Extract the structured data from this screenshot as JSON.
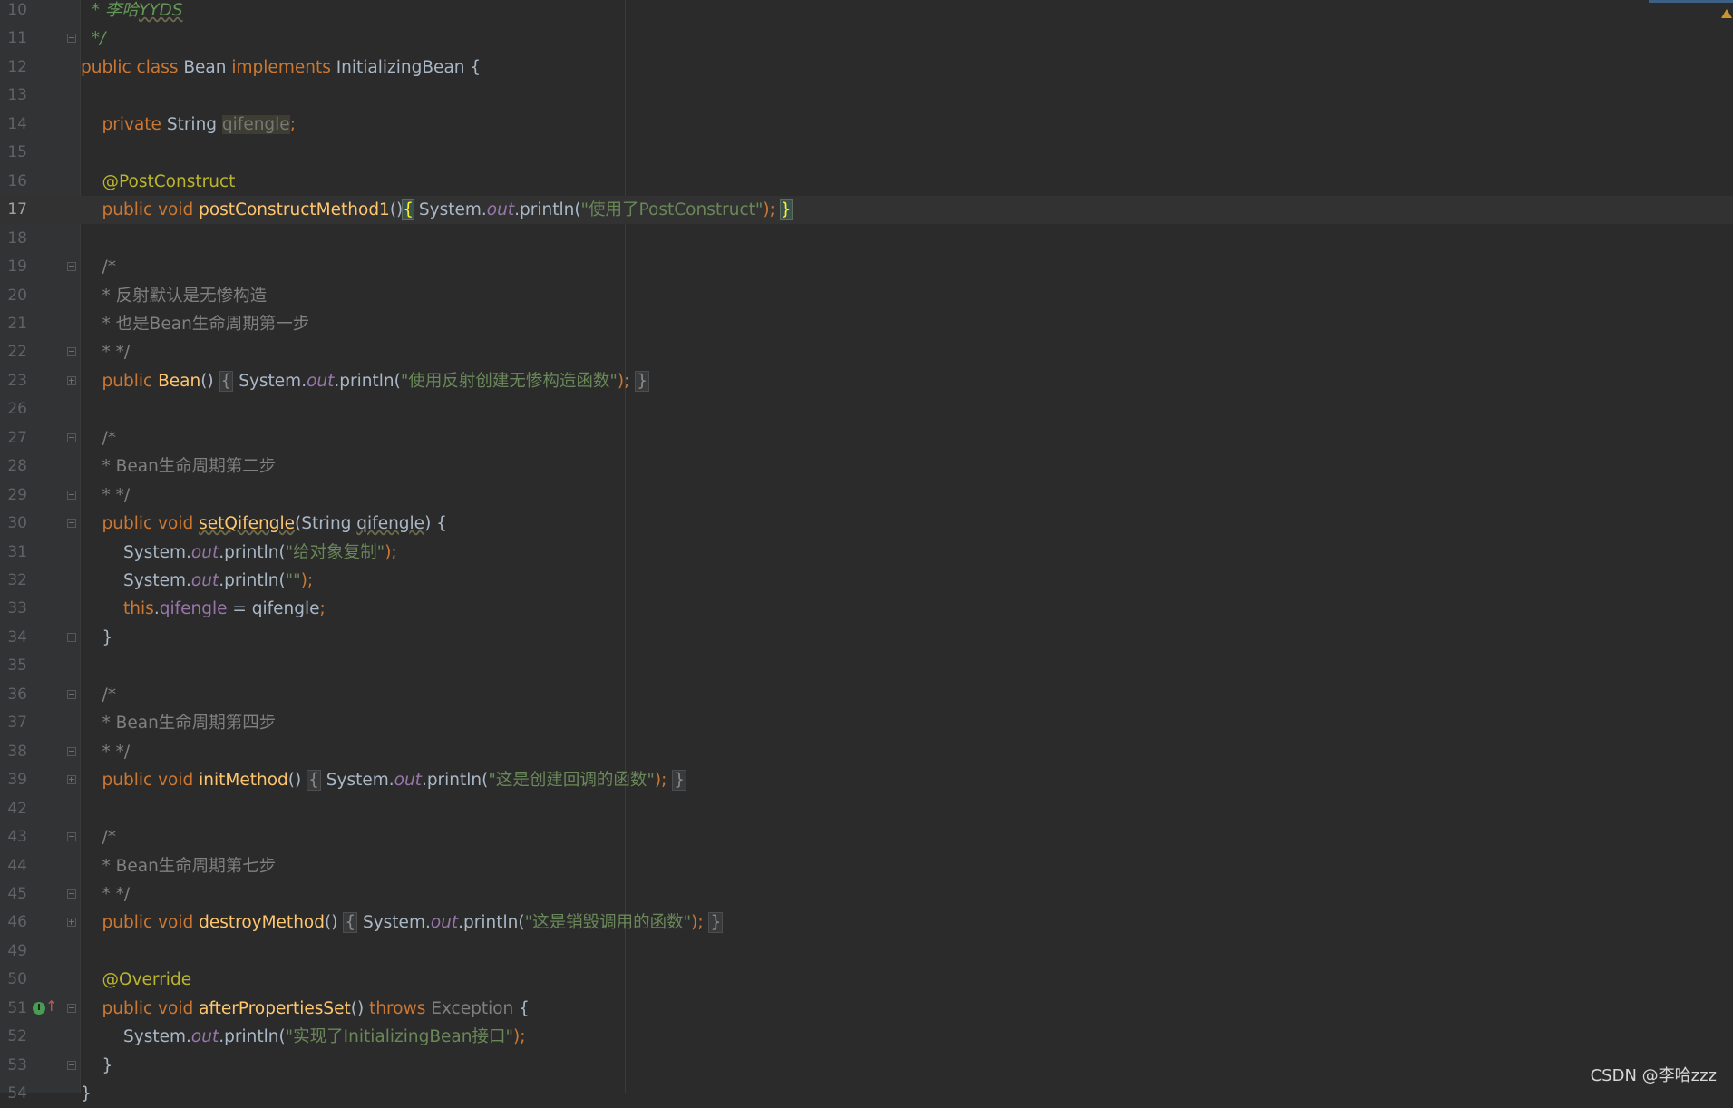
{
  "editor": {
    "lines": [
      {
        "n": "10",
        "tokens": [
          {
            "t": "  ",
            "c": ""
          },
          {
            "t": "* 李哈",
            "c": "doc"
          },
          {
            "t": "YYDS",
            "c": "doc squig"
          }
        ]
      },
      {
        "n": "11",
        "tokens": [
          {
            "t": "  ",
            "c": ""
          },
          {
            "t": "*/",
            "c": "doc"
          }
        ]
      },
      {
        "n": "12",
        "tokens": [
          {
            "t": "public class ",
            "c": "kw"
          },
          {
            "t": "Bean ",
            "c": "cls"
          },
          {
            "t": "implements ",
            "c": "kw"
          },
          {
            "t": "InitializingBean {",
            "c": "cls"
          }
        ]
      },
      {
        "n": "13",
        "tokens": []
      },
      {
        "n": "14",
        "tokens": [
          {
            "t": "    ",
            "c": ""
          },
          {
            "t": "private ",
            "c": "kw"
          },
          {
            "t": "String ",
            "c": "cls"
          },
          {
            "t": "qifengle",
            "c": "unused"
          },
          {
            "t": ";",
            "c": "kw"
          }
        ]
      },
      {
        "n": "15",
        "tokens": []
      },
      {
        "n": "16",
        "tokens": [
          {
            "t": "    ",
            "c": ""
          },
          {
            "t": "@PostConstruct",
            "c": "ann"
          }
        ]
      },
      {
        "n": "17",
        "tokens": [
          {
            "t": "    ",
            "c": ""
          },
          {
            "t": "public void ",
            "c": "kw"
          },
          {
            "t": "postConstructMethod1",
            "c": "fn"
          },
          {
            "t": "()",
            "c": "cls"
          },
          {
            "t": "{",
            "c": "brace-hl"
          },
          {
            "t": " System.",
            "c": "cls"
          },
          {
            "t": "out",
            "c": "sfld"
          },
          {
            "t": ".println(",
            "c": "cls"
          },
          {
            "t": "\"使用了PostConstruct\"",
            "c": "str"
          },
          {
            "t": ");",
            "c": "kw"
          },
          {
            "t": " ",
            "c": ""
          },
          {
            "t": "}",
            "c": "brace-hl"
          }
        ]
      },
      {
        "n": "18",
        "tokens": []
      },
      {
        "n": "19",
        "tokens": [
          {
            "t": "    ",
            "c": ""
          },
          {
            "t": "/*",
            "c": "cmt"
          }
        ]
      },
      {
        "n": "20",
        "tokens": [
          {
            "t": "    ",
            "c": ""
          },
          {
            "t": "* 反射默认是无惨构造",
            "c": "cmt"
          }
        ]
      },
      {
        "n": "21",
        "tokens": [
          {
            "t": "    ",
            "c": ""
          },
          {
            "t": "* 也是Bean生命周期第一步",
            "c": "cmt"
          }
        ]
      },
      {
        "n": "22",
        "tokens": [
          {
            "t": "    ",
            "c": ""
          },
          {
            "t": "* */",
            "c": "cmt"
          }
        ]
      },
      {
        "n": "23",
        "tokens": [
          {
            "t": "    ",
            "c": ""
          },
          {
            "t": "public ",
            "c": "kw"
          },
          {
            "t": "Bean",
            "c": "fn"
          },
          {
            "t": "() ",
            "c": "cls"
          },
          {
            "t": "{",
            "c": "fold-box"
          },
          {
            "t": " System.",
            "c": "cls"
          },
          {
            "t": "out",
            "c": "sfld"
          },
          {
            "t": ".println(",
            "c": "cls"
          },
          {
            "t": "\"使用反射创建无惨构造函数\"",
            "c": "str"
          },
          {
            "t": ");",
            "c": "kw"
          },
          {
            "t": " ",
            "c": ""
          },
          {
            "t": "}",
            "c": "fold-box"
          }
        ]
      },
      {
        "n": "26",
        "tokens": []
      },
      {
        "n": "27",
        "tokens": [
          {
            "t": "    ",
            "c": ""
          },
          {
            "t": "/*",
            "c": "cmt"
          }
        ]
      },
      {
        "n": "28",
        "tokens": [
          {
            "t": "    ",
            "c": ""
          },
          {
            "t": "* Bean生命周期第二步",
            "c": "cmt"
          }
        ]
      },
      {
        "n": "29",
        "tokens": [
          {
            "t": "    ",
            "c": ""
          },
          {
            "t": "* */",
            "c": "cmt"
          }
        ]
      },
      {
        "n": "30",
        "tokens": [
          {
            "t": "    ",
            "c": ""
          },
          {
            "t": "public void ",
            "c": "kw"
          },
          {
            "t": "setQifengle",
            "c": "fn squig"
          },
          {
            "t": "(String ",
            "c": "cls"
          },
          {
            "t": "qifengle",
            "c": "cls squig"
          },
          {
            "t": ") {",
            "c": "cls"
          }
        ]
      },
      {
        "n": "31",
        "tokens": [
          {
            "t": "        System.",
            "c": "cls"
          },
          {
            "t": "out",
            "c": "sfld"
          },
          {
            "t": ".println(",
            "c": "cls"
          },
          {
            "t": "\"给对象复制\"",
            "c": "str"
          },
          {
            "t": ");",
            "c": "kw"
          }
        ]
      },
      {
        "n": "32",
        "tokens": [
          {
            "t": "        System.",
            "c": "cls"
          },
          {
            "t": "out",
            "c": "sfld"
          },
          {
            "t": ".println(",
            "c": "cls"
          },
          {
            "t": "\"\"",
            "c": "str"
          },
          {
            "t": ");",
            "c": "kw"
          }
        ]
      },
      {
        "n": "33",
        "tokens": [
          {
            "t": "        ",
            "c": ""
          },
          {
            "t": "this",
            "c": "kw"
          },
          {
            "t": ".",
            "c": "cls"
          },
          {
            "t": "qifengle",
            "c": "fld"
          },
          {
            "t": " = qifengle",
            "c": "cls"
          },
          {
            "t": ";",
            "c": "kw"
          }
        ]
      },
      {
        "n": "34",
        "tokens": [
          {
            "t": "    }",
            "c": "cls"
          }
        ]
      },
      {
        "n": "35",
        "tokens": []
      },
      {
        "n": "36",
        "tokens": [
          {
            "t": "    ",
            "c": ""
          },
          {
            "t": "/*",
            "c": "cmt"
          }
        ]
      },
      {
        "n": "37",
        "tokens": [
          {
            "t": "    ",
            "c": ""
          },
          {
            "t": "* Bean生命周期第四步",
            "c": "cmt"
          }
        ]
      },
      {
        "n": "38",
        "tokens": [
          {
            "t": "    ",
            "c": ""
          },
          {
            "t": "* */",
            "c": "cmt"
          }
        ]
      },
      {
        "n": "39",
        "tokens": [
          {
            "t": "    ",
            "c": ""
          },
          {
            "t": "public void ",
            "c": "kw"
          },
          {
            "t": "initMethod",
            "c": "fn"
          },
          {
            "t": "() ",
            "c": "cls"
          },
          {
            "t": "{",
            "c": "fold-box"
          },
          {
            "t": " System.",
            "c": "cls"
          },
          {
            "t": "out",
            "c": "sfld"
          },
          {
            "t": ".println(",
            "c": "cls"
          },
          {
            "t": "\"这是创建回调的函数\"",
            "c": "str"
          },
          {
            "t": ");",
            "c": "kw"
          },
          {
            "t": " ",
            "c": ""
          },
          {
            "t": "}",
            "c": "fold-box"
          }
        ]
      },
      {
        "n": "42",
        "tokens": []
      },
      {
        "n": "43",
        "tokens": [
          {
            "t": "    ",
            "c": ""
          },
          {
            "t": "/*",
            "c": "cmt"
          }
        ]
      },
      {
        "n": "44",
        "tokens": [
          {
            "t": "    ",
            "c": ""
          },
          {
            "t": "* Bean生命周期第七步",
            "c": "cmt"
          }
        ]
      },
      {
        "n": "45",
        "tokens": [
          {
            "t": "    ",
            "c": ""
          },
          {
            "t": "* */",
            "c": "cmt"
          }
        ]
      },
      {
        "n": "46",
        "tokens": [
          {
            "t": "    ",
            "c": ""
          },
          {
            "t": "public void ",
            "c": "kw"
          },
          {
            "t": "destroyMethod",
            "c": "fn"
          },
          {
            "t": "() ",
            "c": "cls"
          },
          {
            "t": "{",
            "c": "fold-box"
          },
          {
            "t": " System.",
            "c": "cls"
          },
          {
            "t": "out",
            "c": "sfld"
          },
          {
            "t": ".println(",
            "c": "cls"
          },
          {
            "t": "\"这是销毁调用的函数\"",
            "c": "str"
          },
          {
            "t": ");",
            "c": "kw"
          },
          {
            "t": " ",
            "c": ""
          },
          {
            "t": "}",
            "c": "fold-box"
          }
        ]
      },
      {
        "n": "49",
        "tokens": []
      },
      {
        "n": "50",
        "tokens": [
          {
            "t": "    ",
            "c": ""
          },
          {
            "t": "@Override",
            "c": "ann"
          }
        ]
      },
      {
        "n": "51",
        "tokens": [
          {
            "t": "    ",
            "c": ""
          },
          {
            "t": "public void ",
            "c": "kw"
          },
          {
            "t": "afterPropertiesSet",
            "c": "fn"
          },
          {
            "t": "() ",
            "c": "cls"
          },
          {
            "t": "throws ",
            "c": "kw"
          },
          {
            "t": "Exception ",
            "c": "cmt"
          },
          {
            "t": "{",
            "c": "cls"
          }
        ]
      },
      {
        "n": "52",
        "tokens": [
          {
            "t": "        System.",
            "c": "cls"
          },
          {
            "t": "out",
            "c": "sfld"
          },
          {
            "t": ".println(",
            "c": "cls"
          },
          {
            "t": "\"实现了InitializingBean接口\"",
            "c": "str"
          },
          {
            "t": ");",
            "c": "kw"
          }
        ]
      },
      {
        "n": "53",
        "tokens": [
          {
            "t": "    }",
            "c": "cls"
          }
        ]
      },
      {
        "n": "54",
        "tokens": [
          {
            "t": "}",
            "c": "cls"
          }
        ]
      }
    ],
    "current_line": "17",
    "fold_markers": {
      "11": "end",
      "19": "start",
      "22": "end",
      "23": "collapsed",
      "27": "start",
      "29": "end",
      "30": "start",
      "34": "end",
      "36": "start",
      "38": "end",
      "39": "collapsed",
      "43": "start",
      "45": "end",
      "46": "collapsed",
      "51": "start",
      "53": "end"
    },
    "override_marker_line": "51",
    "override_icon_glyph": "I",
    "override_arrow_glyph": "↑"
  },
  "watermark": "CSDN @李哈zzz",
  "colors": {
    "background": "#2b2b2b",
    "gutter": "#313335",
    "keyword": "#cc7832",
    "function": "#ffc66d",
    "string": "#6a8759",
    "comment": "#808080",
    "annotation": "#bbb529",
    "field": "#9876aa"
  }
}
